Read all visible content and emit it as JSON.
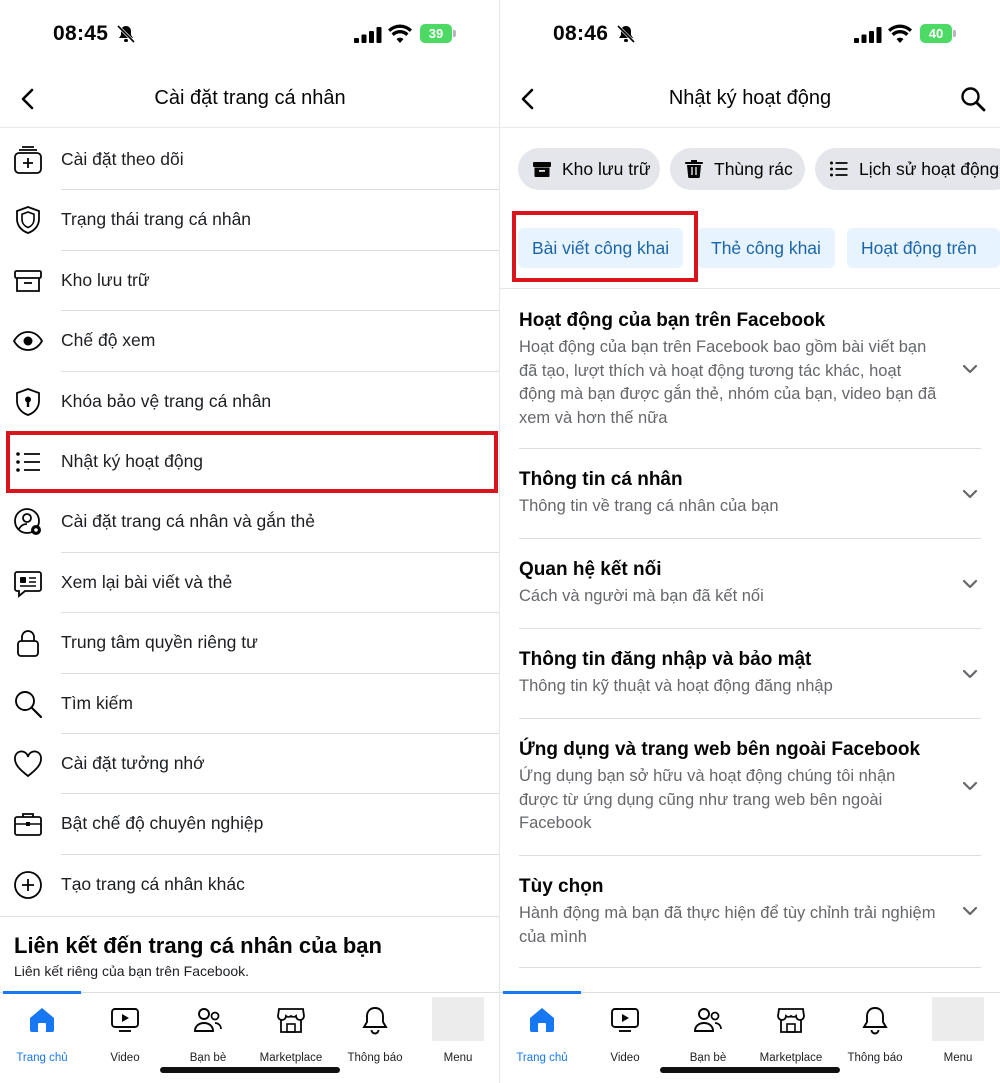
{
  "left": {
    "status": {
      "time": "08:45",
      "battery": "39"
    },
    "header": {
      "title": "Cài đặt trang cá nhân"
    },
    "menu": [
      {
        "label": "Cài đặt theo dõi",
        "icon": "follow-settings-icon"
      },
      {
        "label": "Trạng thái trang cá nhân",
        "icon": "shield-icon"
      },
      {
        "label": "Kho lưu trữ",
        "icon": "archive-icon"
      },
      {
        "label": "Chế độ xem",
        "icon": "eye-icon"
      },
      {
        "label": "Khóa bảo vệ trang cá nhân",
        "icon": "profile-lock-icon"
      },
      {
        "label": "Nhật ký hoạt động",
        "icon": "list-icon"
      },
      {
        "label": "Cài đặt trang cá nhân và gắn thẻ",
        "icon": "user-gear-icon"
      },
      {
        "label": "Xem lại bài viết và thẻ",
        "icon": "review-posts-icon"
      },
      {
        "label": "Trung tâm quyền riêng tư",
        "icon": "lock-icon"
      },
      {
        "label": "Tìm kiếm",
        "icon": "search-icon"
      },
      {
        "label": "Cài đặt tưởng nhớ",
        "icon": "heart-icon"
      },
      {
        "label": "Bật chế độ chuyên nghiệp",
        "icon": "briefcase-icon"
      },
      {
        "label": "Tạo trang cá nhân khác",
        "icon": "plus-circle-icon"
      }
    ],
    "link_section": {
      "title": "Liên kết đến trang cá nhân của bạn",
      "subtitle": "Liên kết riêng của bạn trên Facebook."
    }
  },
  "right": {
    "status": {
      "time": "08:46",
      "battery": "40"
    },
    "header": {
      "title": "Nhật ký hoạt động"
    },
    "chips": [
      {
        "label": "Kho lưu trữ",
        "icon": "archive-icon"
      },
      {
        "label": "Thùng rác",
        "icon": "trash-icon"
      },
      {
        "label": "Lịch sử hoạt động",
        "icon": "list-icon"
      }
    ],
    "tabs": [
      {
        "label": "Bài viết công khai"
      },
      {
        "label": "Thẻ công khai"
      },
      {
        "label": "Hoạt động trên"
      }
    ],
    "sections": [
      {
        "title": "Hoạt động của bạn trên Facebook",
        "desc": "Hoạt động của bạn trên Facebook bao gồm bài viết bạn đã tạo, lượt thích và hoạt động tương tác khác, hoạt động mà bạn được gắn thẻ, nhóm của bạn, video bạn đã xem và hơn thế nữa"
      },
      {
        "title": "Thông tin cá nhân",
        "desc": "Thông tin về trang cá nhân của bạn"
      },
      {
        "title": "Quan hệ kết nối",
        "desc": "Cách và người mà bạn đã kết nối"
      },
      {
        "title": "Thông tin đăng nhập và bảo mật",
        "desc": "Thông tin kỹ thuật và hoạt động đăng nhập"
      },
      {
        "title": "Ứng dụng và trang web bên ngoài Facebook",
        "desc": "Ứng dụng bạn sở hữu và hoạt động chúng tôi nhận được từ ứng dụng cũng như trang web bên ngoài Facebook"
      },
      {
        "title": "Tùy chọn",
        "desc": "Hành động mà bạn đã thực hiện để tùy chỉnh trải nghiệm của mình"
      }
    ]
  },
  "bottom_nav": [
    {
      "label": "Trang chủ",
      "icon": "home-icon",
      "active": true
    },
    {
      "label": "Video",
      "icon": "video-icon"
    },
    {
      "label": "Bạn bè",
      "icon": "friends-icon"
    },
    {
      "label": "Marketplace",
      "icon": "marketplace-icon"
    },
    {
      "label": "Thông báo",
      "icon": "bell-icon"
    },
    {
      "label": "Menu",
      "icon": "avatar"
    }
  ],
  "colors": {
    "accent": "#1877f2",
    "highlight": "#d9141b",
    "tab_bg": "#e7f3ff",
    "tab_text": "#1b66a8",
    "battery": "#4cd964"
  }
}
